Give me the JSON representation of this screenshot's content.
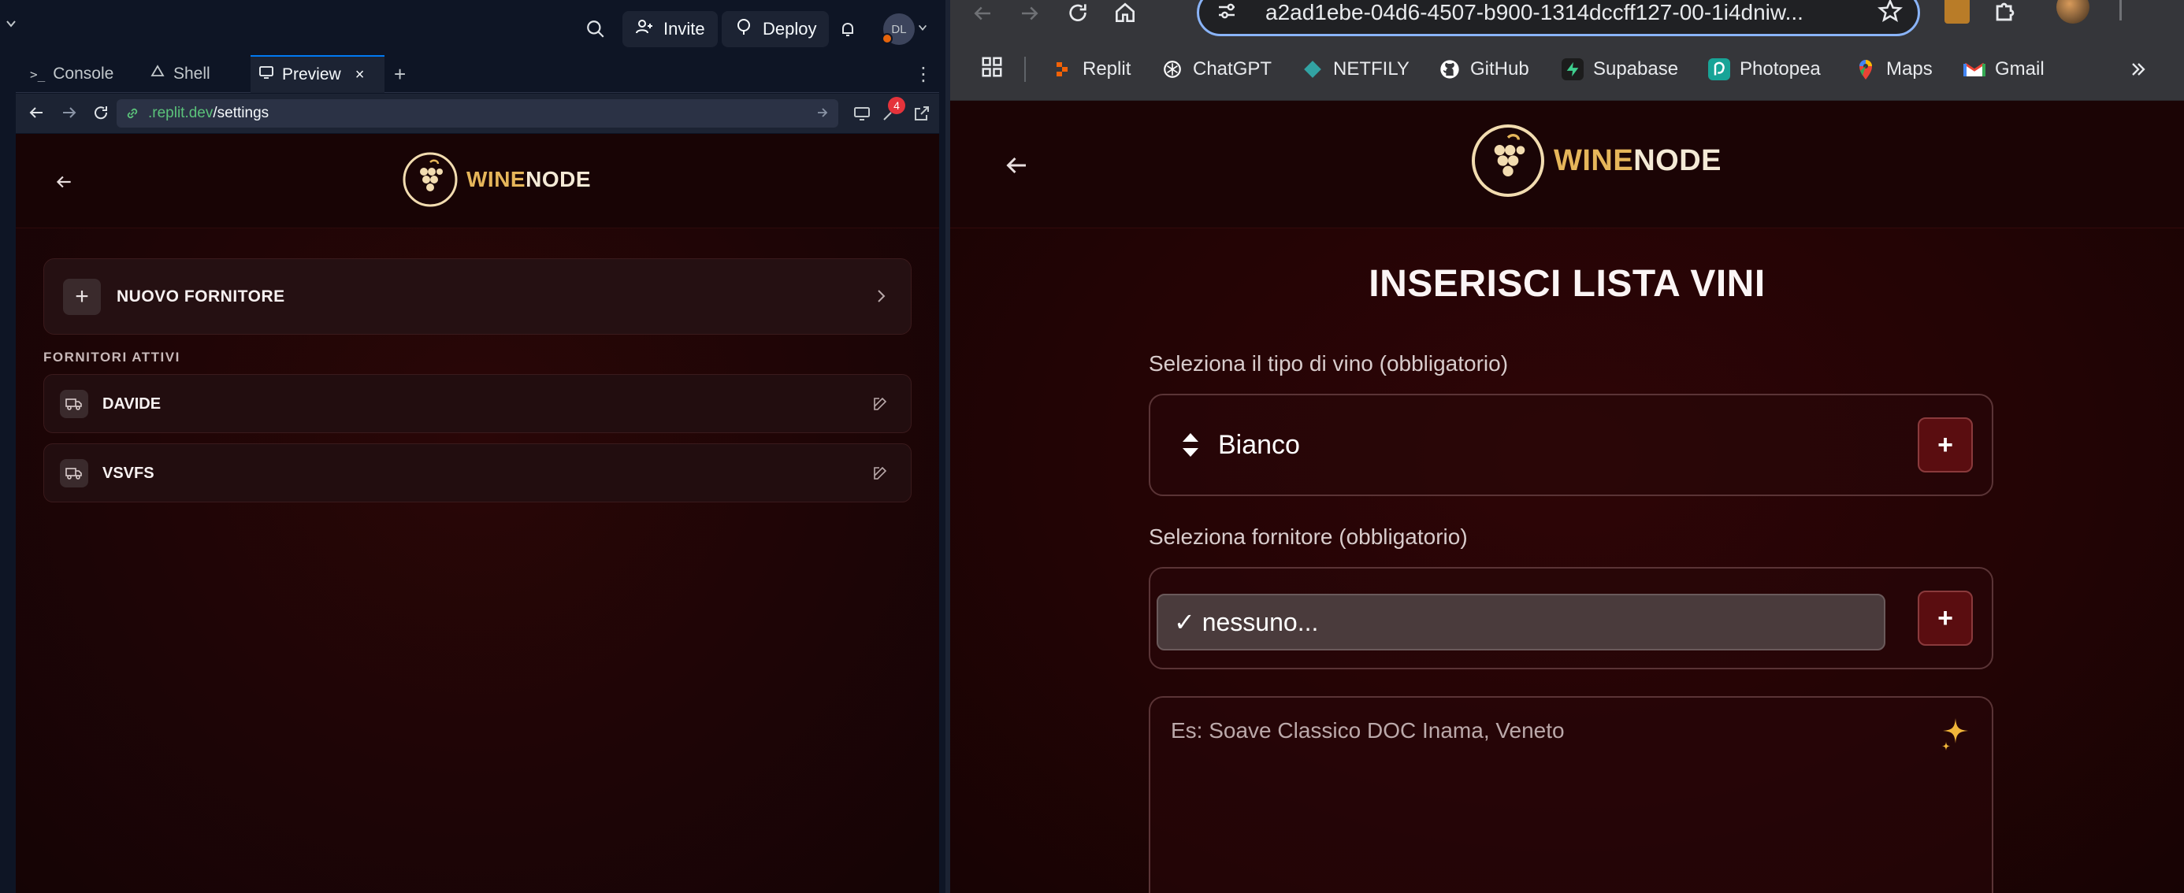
{
  "replit": {
    "header": {
      "invite_label": "Invite",
      "deploy_label": "Deploy",
      "avatar_initials": "DL"
    },
    "tabs": [
      {
        "label": "Console",
        "glyph": ">_"
      },
      {
        "label": "Shell"
      },
      {
        "label": "Preview",
        "active": true
      }
    ],
    "preview": {
      "url_host": ".replit.dev",
      "url_path": "/settings",
      "badge_count": "4"
    }
  },
  "left_app": {
    "logo": {
      "wine": "WINE",
      "node": "NODE"
    },
    "new_supplier_label": "NUOVO FORNITORE",
    "section_label": "FORNITORI ATTIVI",
    "suppliers": [
      {
        "name": "DAVIDE"
      },
      {
        "name": "VSVFS"
      }
    ]
  },
  "browser": {
    "url": "a2ad1ebe-04d6-4507-b900-1314dccff127-00-1i4dniw...",
    "bookmarks": [
      {
        "label": "Replit",
        "icon": "replit-icon",
        "color": "#f26207"
      },
      {
        "label": "ChatGPT",
        "icon": "chatgpt-icon",
        "color": "#ffffff"
      },
      {
        "label": "NETFILY",
        "icon": "netlify-icon",
        "color": "#32a3a3"
      },
      {
        "label": "GitHub",
        "icon": "github-icon",
        "color": "#ffffff"
      },
      {
        "label": "Supabase",
        "icon": "supabase-icon",
        "color": "#3ecf8e"
      },
      {
        "label": "Photopea",
        "icon": "photopea-icon",
        "color": "#18a497"
      },
      {
        "label": "Maps",
        "icon": "maps-icon",
        "color": "#34a853"
      },
      {
        "label": "Gmail",
        "icon": "gmail-icon",
        "color": "#ea4335"
      }
    ]
  },
  "right_app": {
    "logo": {
      "wine": "WINE",
      "node": "NODE"
    },
    "title": "INSERISCI LISTA VINI",
    "wine_type_label": "Seleziona il tipo di vino (obbligatorio)",
    "wine_type_value": "Bianco",
    "supplier_label": "Seleziona fornitore (obbligatorio)",
    "supplier_value": "✓ nessuno...",
    "textarea_placeholder": "Es: Soave Classico DOC Inama, Veneto"
  },
  "colors": {
    "brand_gold": "#e6b65a",
    "brand_bg": "#1e0506",
    "accent_button": "#5a0d10",
    "replit_blue": "#0079f2"
  }
}
